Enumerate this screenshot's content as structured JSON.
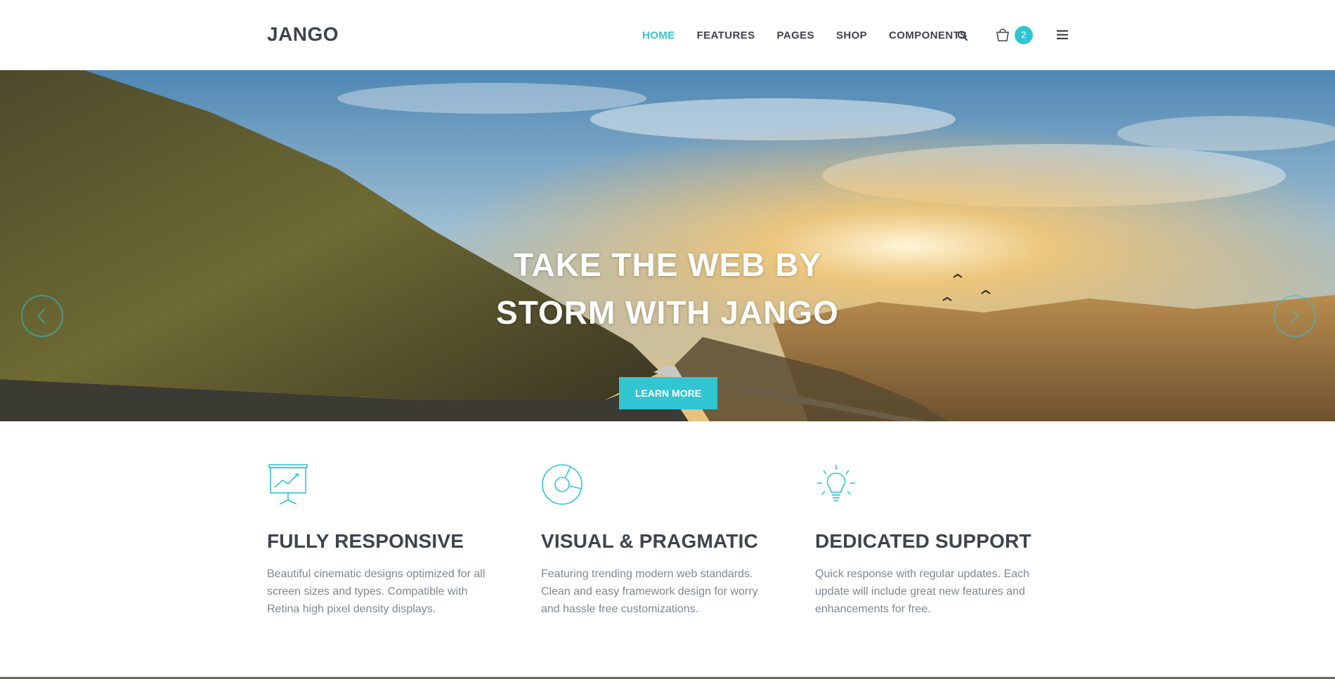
{
  "header": {
    "logo": "JANGO",
    "nav": [
      "HOME",
      "FEATURES",
      "PAGES",
      "SHOP",
      "COMPONENTS"
    ],
    "cart_count": "2",
    "icons": [
      "search-icon",
      "cart-icon",
      "menu-icon"
    ]
  },
  "hero": {
    "title_line1": "TAKE THE WEB BY",
    "title_line2": "STORM WITH JANGO",
    "button": "LEARN MORE"
  },
  "features": [
    {
      "icon": "presentation-chart-icon",
      "title": "FULLY RESPONSIVE",
      "desc": "Beautiful cinematic designs optimized for all screen sizes and types. Compatible with Retina high pixel density displays."
    },
    {
      "icon": "pie-chart-icon",
      "title": "VISUAL & PRAGMATIC",
      "desc": "Featuring trending modern web standards. Clean and easy framework design for worry and hassle free customizations."
    },
    {
      "icon": "lightbulb-icon",
      "title": "DEDICATED SUPPORT",
      "desc": "Quick response with regular updates. Each update will include great new features and enhancements for free."
    }
  ],
  "colors": {
    "accent": "#32c5d2",
    "text_dark": "#3f444a",
    "text_muted": "#7f8891"
  }
}
